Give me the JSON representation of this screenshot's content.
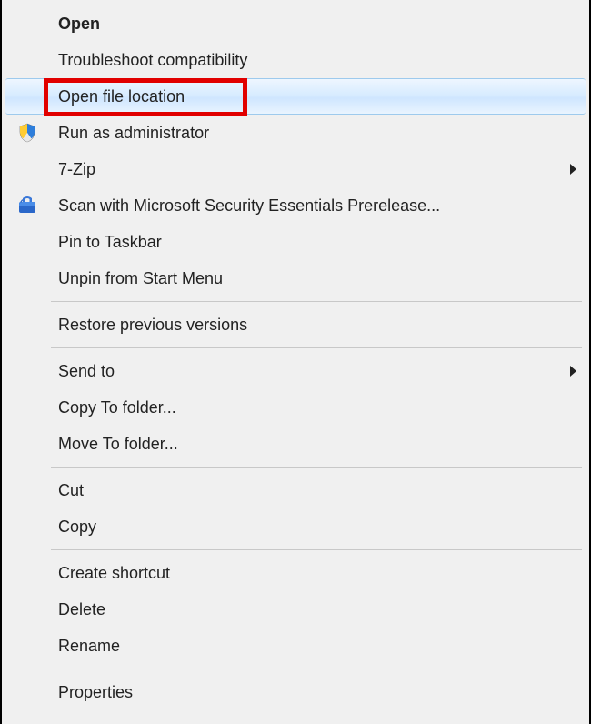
{
  "menu": {
    "items": [
      {
        "label": "Open",
        "bold": true
      },
      {
        "label": "Troubleshoot compatibility"
      },
      {
        "label": "Open file location",
        "hover": true,
        "highlighted": true
      },
      {
        "label": "Run as administrator",
        "icon": "shield"
      },
      {
        "label": "7-Zip",
        "submenu": true
      },
      {
        "label": "Scan with Microsoft Security Essentials Prerelease...",
        "icon": "mse"
      },
      {
        "label": "Pin to Taskbar"
      },
      {
        "label": "Unpin from Start Menu"
      },
      {
        "sep": true
      },
      {
        "label": "Restore previous versions"
      },
      {
        "sep": true
      },
      {
        "label": "Send to",
        "submenu": true
      },
      {
        "label": "Copy To folder..."
      },
      {
        "label": "Move To folder..."
      },
      {
        "sep": true
      },
      {
        "label": "Cut"
      },
      {
        "label": "Copy"
      },
      {
        "sep": true
      },
      {
        "label": "Create shortcut"
      },
      {
        "label": "Delete"
      },
      {
        "label": "Rename"
      },
      {
        "sep": true
      },
      {
        "label": "Properties"
      }
    ]
  },
  "highlight": {
    "target": "Open file location",
    "color": "#e10000"
  }
}
